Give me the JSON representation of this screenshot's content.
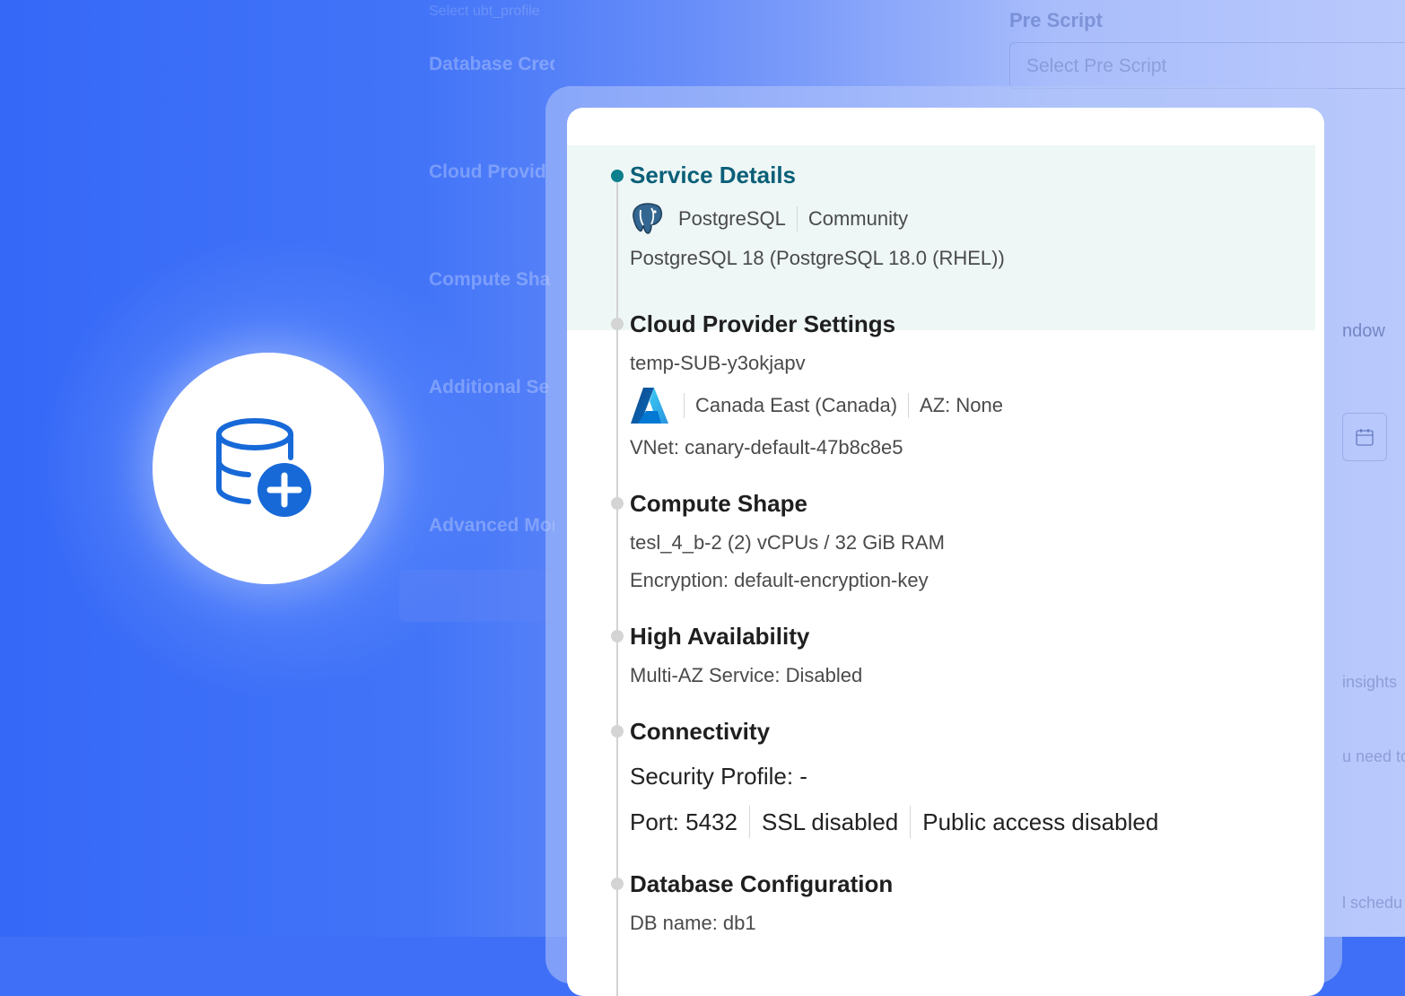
{
  "background_form": {
    "left_fragments": [
      "Select ubt_profile",
      "Database Credentials",
      "Cloud Provid",
      "Compute Sha",
      "Additional Se",
      "Advanced Moni"
    ],
    "pre_script_label": "Pre Script",
    "pre_script_placeholder": "Select Pre Script",
    "right_fragments": [
      "ndow",
      "insights",
      "u need to",
      "l schedu"
    ]
  },
  "icons": {
    "hero": "database-add-icon",
    "postgres": "postgresql-logo-icon",
    "azure": "azure-logo-icon",
    "calendar": "calendar-icon"
  },
  "colors": {
    "accent": "#0b5f78",
    "active_dot": "#0e7f8c",
    "icon_blue": "#1769d8",
    "background_blue": "#3f6ff6"
  },
  "summary": {
    "service_details": {
      "title": "Service Details",
      "engine": "PostgreSQL",
      "edition": "Community",
      "version": "PostgreSQL 18 (PostgreSQL 18.0 (RHEL))"
    },
    "cloud_provider": {
      "title": "Cloud Provider Settings",
      "subscription": "temp-SUB-y3okjapv",
      "region": "Canada East (Canada)",
      "az": "AZ: None",
      "vnet": "VNet: canary-default-47b8c8e5"
    },
    "compute_shape": {
      "title": "Compute Shape",
      "shape": "tesl_4_b-2 (2) vCPUs / 32 GiB RAM",
      "encryption": "Encryption: default-encryption-key"
    },
    "high_availability": {
      "title": "High Availability",
      "multi_az": "Multi-AZ Service: Disabled"
    },
    "connectivity": {
      "title": "Connectivity",
      "security_profile": "Security Profile: -",
      "port": "Port: 5432",
      "ssl": "SSL disabled",
      "public_access": "Public access disabled"
    },
    "database_configuration": {
      "title": "Database Configuration",
      "db_name": "DB name: db1"
    }
  }
}
